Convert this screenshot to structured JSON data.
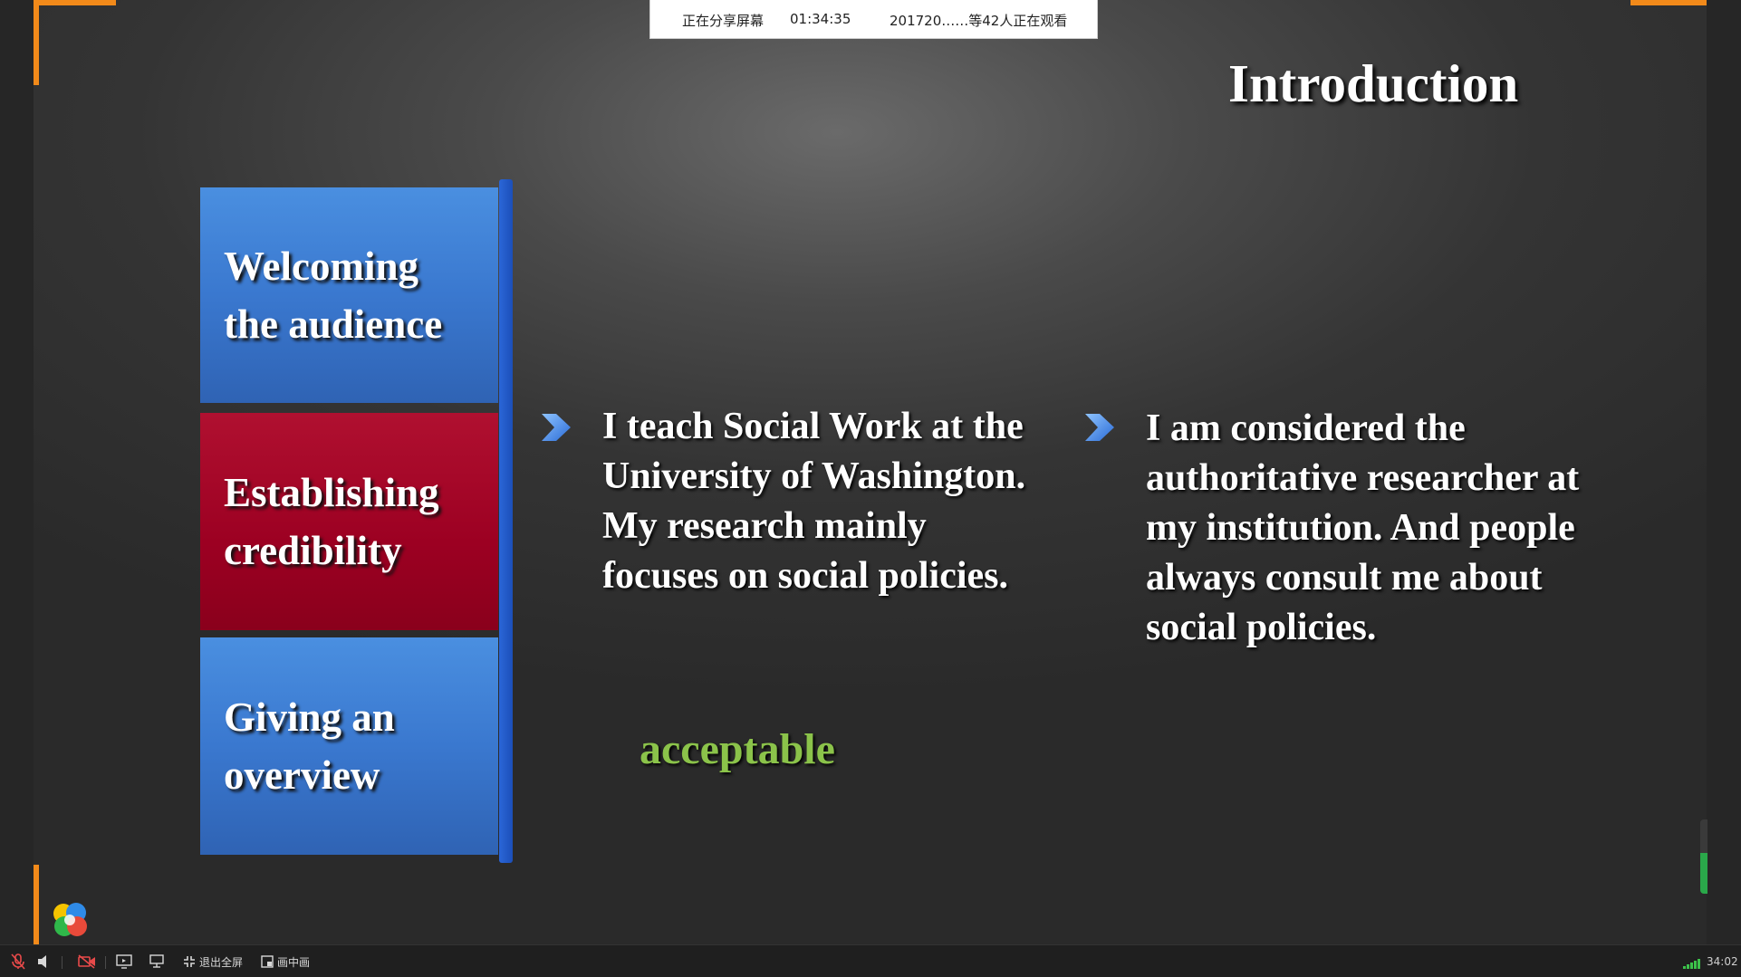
{
  "share_bar": {
    "status": "正在分享屏幕",
    "elapsed": "01:34:35",
    "viewers": "201720……等42人正在观看"
  },
  "slide": {
    "title": "Introduction",
    "boxes": [
      {
        "line1": "Welcoming",
        "line2": "the audience",
        "color": "#3a78cf"
      },
      {
        "line1": "Establishing",
        "line2": "credibility",
        "color": "#9c0022"
      },
      {
        "line1": "Giving an",
        "line2": "overview",
        "color": "#3a78cf"
      }
    ],
    "bullets": [
      {
        "lines": [
          "I teach Social Work at the",
          "University of Washington.",
          "My research mainly",
          "focuses on social policies."
        ]
      },
      {
        "lines": [
          "I am considered the",
          "authoritative researcher at",
          "my institution. And people",
          "always consult me about",
          "social policies."
        ]
      }
    ],
    "annotation": "acceptable",
    "annotation_color": "#8bc34a",
    "accent_color": "#f28a1a"
  },
  "taskbar": {
    "exit_fullscreen_label": "退出全屏",
    "pip_label": "画中画",
    "time": "34:02",
    "icons": [
      "mic-muted-icon",
      "speaker-icon",
      "camera-off-icon",
      "screen-share-icon",
      "chat-icon",
      "exit-fullscreen-icon",
      "picture-in-picture-icon",
      "signal-icon"
    ]
  }
}
